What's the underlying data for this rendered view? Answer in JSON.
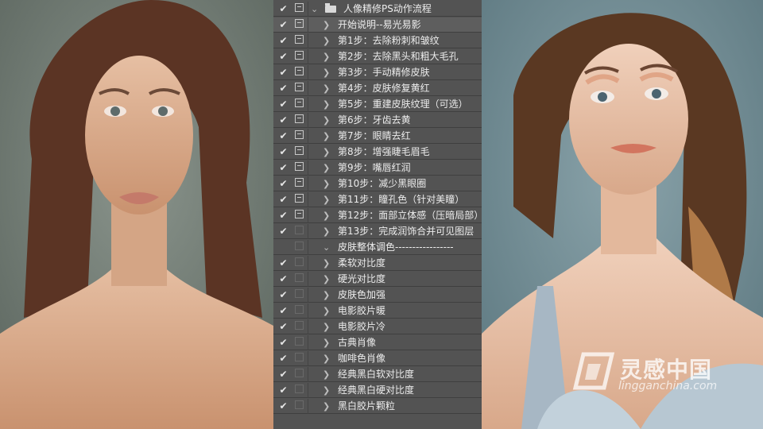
{
  "actions_panel": {
    "set_name": "人像精修PS动作流程",
    "actions": [
      {
        "label": "开始说明--易光易影",
        "checked": true,
        "dialog": true,
        "selected": true
      },
      {
        "label": "第1步：去除粉刺和皱纹",
        "checked": true,
        "dialog": true
      },
      {
        "label": "第2步：去除黑头和粗大毛孔",
        "checked": true,
        "dialog": true
      },
      {
        "label": "第3步：手动精修皮肤",
        "checked": true,
        "dialog": true
      },
      {
        "label": "第4步：皮肤修复黄红",
        "checked": true,
        "dialog": true
      },
      {
        "label": "第5步：重建皮肤纹理（可选）",
        "checked": true,
        "dialog": true
      },
      {
        "label": "第6步：牙齿去黄",
        "checked": true,
        "dialog": true
      },
      {
        "label": "第7步：眼睛去红",
        "checked": true,
        "dialog": true
      },
      {
        "label": "第8步：增强睫毛眉毛",
        "checked": true,
        "dialog": true
      },
      {
        "label": "第9步：嘴唇红润",
        "checked": true,
        "dialog": true
      },
      {
        "label": "第10步：减少黑眼圈",
        "checked": true,
        "dialog": true
      },
      {
        "label": "第11步：瞳孔色（针对美瞳）",
        "checked": true,
        "dialog": true
      },
      {
        "label": "第12步：面部立体感（压暗局部）",
        "checked": true,
        "dialog": true
      },
      {
        "label": "第13步：完成润饰合并可见图层",
        "checked": true,
        "dialog": false
      },
      {
        "label": "皮肤整体调色-----------------",
        "checked": false,
        "dialog": false,
        "expanded": true
      },
      {
        "label": "柔软对比度",
        "checked": true,
        "dialog": false
      },
      {
        "label": "硬光对比度",
        "checked": true,
        "dialog": false
      },
      {
        "label": "皮肤色加强",
        "checked": true,
        "dialog": false
      },
      {
        "label": "电影胶片暖",
        "checked": true,
        "dialog": false
      },
      {
        "label": "电影胶片冷",
        "checked": true,
        "dialog": false
      },
      {
        "label": "古典肖像",
        "checked": true,
        "dialog": false
      },
      {
        "label": "咖啡色肖像",
        "checked": true,
        "dialog": false
      },
      {
        "label": "经典黑白软对比度",
        "checked": true,
        "dialog": false
      },
      {
        "label": "经典黑白硬对比度",
        "checked": true,
        "dialog": false
      },
      {
        "label": "黑白胶片颗粒",
        "checked": true,
        "dialog": false
      }
    ]
  },
  "watermark": {
    "cn": "灵感中国",
    "en": "lingganchina.com"
  },
  "colors": {
    "panel_bg": "#535353",
    "left_bg": "#6f7a72",
    "right_bg": "#6f8c95",
    "text": "#ececec"
  },
  "icons": {
    "check": "✔",
    "chevron_right": "❯",
    "chevron_down": "⌄"
  }
}
